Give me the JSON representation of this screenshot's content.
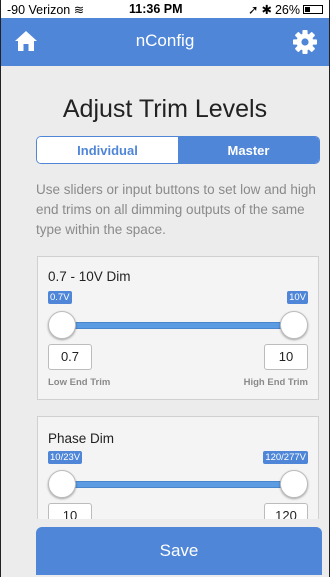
{
  "status_bar": {
    "carrier": "-90 Verizon",
    "time": "11:36 PM",
    "battery": "26%"
  },
  "navbar": {
    "title": "nConfig",
    "left_icon": "home-icon",
    "right_icon": "gear-icon"
  },
  "page": {
    "heading": "Adjust Trim Levels",
    "tabs": [
      {
        "label": "Individual",
        "selected": false
      },
      {
        "label": "Master",
        "selected": true
      }
    ],
    "description": "Use sliders or input buttons to set low and high end trims on all dimming outputs of the same type within the space."
  },
  "cards": [
    {
      "title": "0.7 - 10V Dim",
      "min_badge": "0.7V",
      "max_badge": "10V",
      "low_value": "0.7",
      "high_value": "10",
      "low_label": "Low End Trim",
      "high_label": "High End Trim"
    },
    {
      "title": "Phase Dim",
      "min_badge": "10/23V",
      "max_badge": "120/277V",
      "low_value": "10",
      "high_value": "120"
    }
  ],
  "footer": {
    "save_label": "Save"
  },
  "colors": {
    "accent": "#4f86d8",
    "background": "#ececec",
    "muted_text": "#8a8a8a"
  }
}
